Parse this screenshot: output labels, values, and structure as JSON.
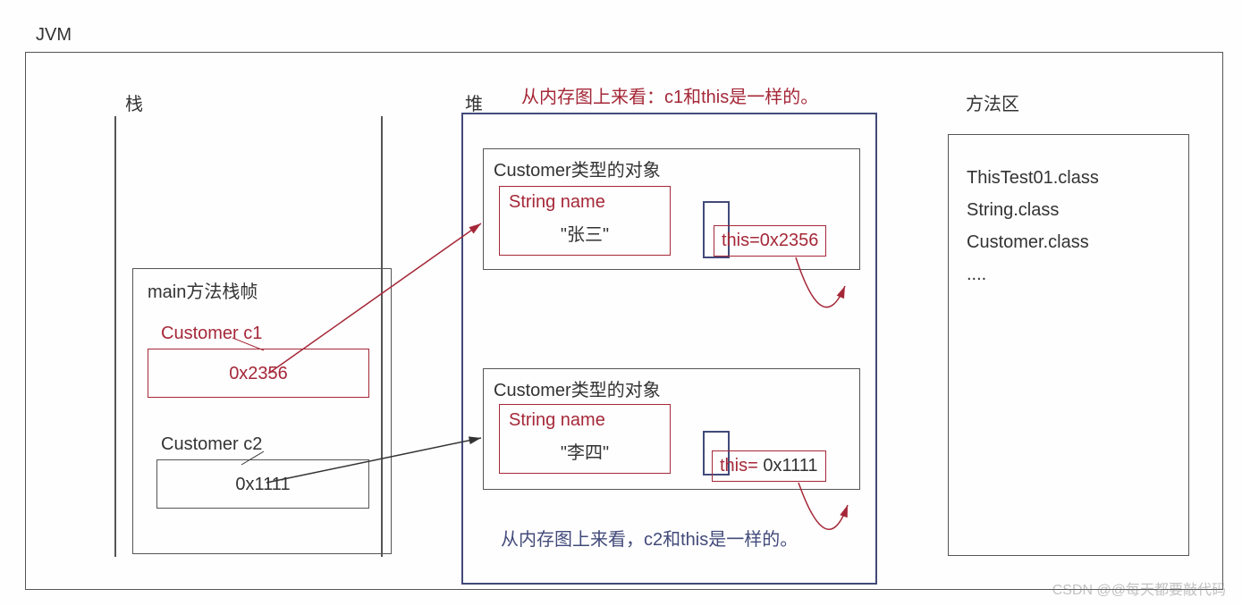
{
  "title": "JVM",
  "sections": {
    "stack": "栈",
    "heap": "堆",
    "methodArea": "方法区"
  },
  "note1": "从内存图上来看：c1和this是一样的。",
  "note2": "从内存图上来看，c2和this是一样的。",
  "mainFrame": {
    "label": "main方法栈帧",
    "c1": {
      "label": "Customer c1",
      "value": "0x2356"
    },
    "c2": {
      "label": "Customer c2",
      "value": "0x1111"
    }
  },
  "heapObjects": {
    "obj1": {
      "label": "Customer类型的对象",
      "nameLabel": "String name",
      "nameValue": "\"张三\"",
      "thisLabel": "this=0x2356"
    },
    "obj2": {
      "label": "Customer类型的对象",
      "nameLabel": "String name",
      "nameValue": "\"李四\"",
      "thisPrefix": "this=",
      "thisValue": "0x1111"
    }
  },
  "methodArea": {
    "items": [
      "ThisTest01.class",
      "String.class",
      "Customer.class",
      "...."
    ]
  },
  "watermark": "CSDN @@每天都要敲代码"
}
